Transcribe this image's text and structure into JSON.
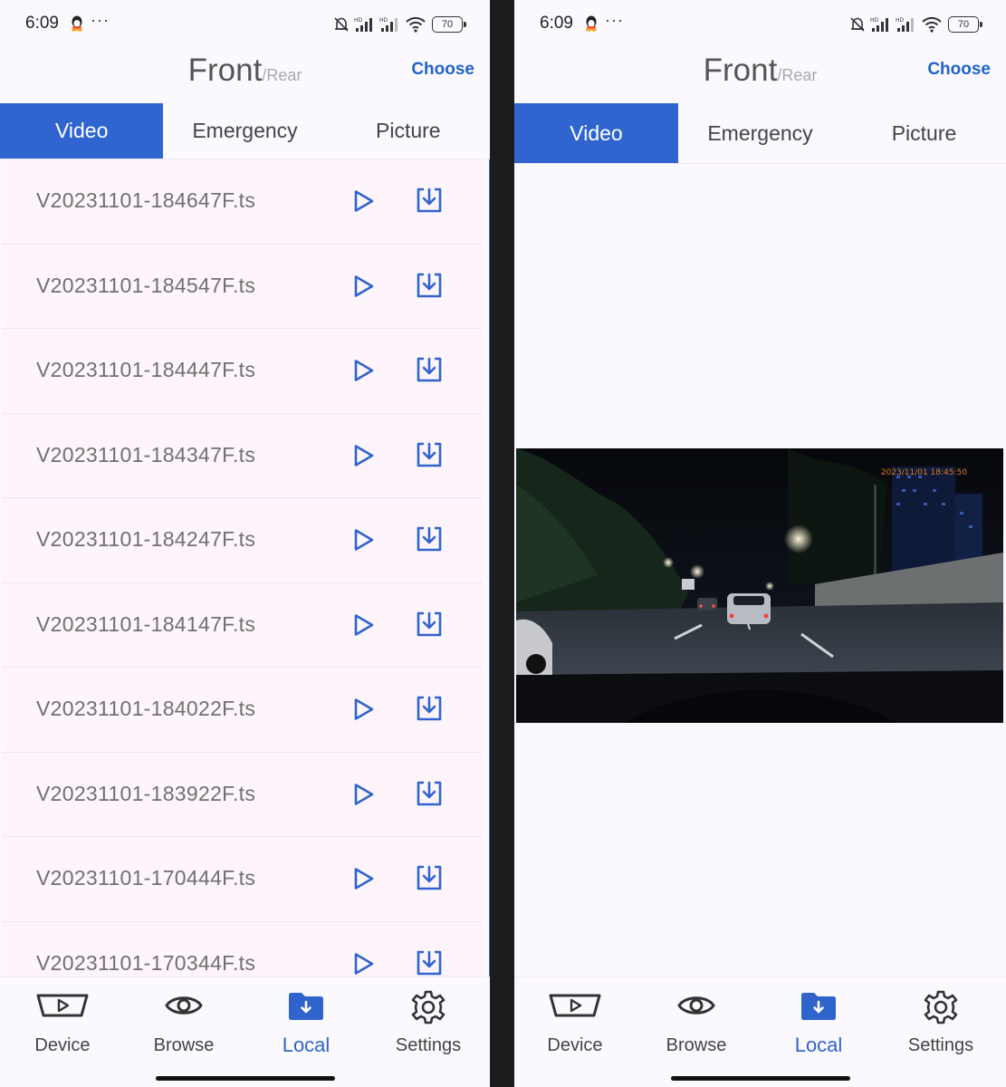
{
  "status": {
    "time": "6:09",
    "more": "···",
    "signal_label": "HD",
    "battery": "70"
  },
  "header": {
    "title": "Front",
    "subtitle": "/Rear",
    "action": "Choose"
  },
  "tabs": [
    {
      "label": "Video",
      "active": true
    },
    {
      "label": "Emergency",
      "active": false
    },
    {
      "label": "Picture",
      "active": false
    }
  ],
  "files": [
    {
      "name": "V20231101-184647F.ts"
    },
    {
      "name": "V20231101-184547F.ts"
    },
    {
      "name": "V20231101-184447F.ts"
    },
    {
      "name": "V20231101-184347F.ts"
    },
    {
      "name": "V20231101-184247F.ts"
    },
    {
      "name": "V20231101-184147F.ts"
    },
    {
      "name": "V20231101-184022F.ts"
    },
    {
      "name": "V20231101-183922F.ts"
    },
    {
      "name": "V20231101-170444F.ts"
    },
    {
      "name": "V20231101-170344F.ts"
    }
  ],
  "player": {
    "timestamp": "2023/11/01 18:45:50"
  },
  "nav": [
    {
      "label": "Device",
      "icon": "dashcam-icon",
      "active": false
    },
    {
      "label": "Browse",
      "icon": "eye-icon",
      "active": false
    },
    {
      "label": "Local",
      "icon": "folder-download-icon",
      "active": true
    },
    {
      "label": "Settings",
      "icon": "gear-icon",
      "active": false
    }
  ],
  "colors": {
    "accent": "#3065d0",
    "list_bg": "#fdf5fb",
    "icon_blue": "#2f64d0"
  }
}
